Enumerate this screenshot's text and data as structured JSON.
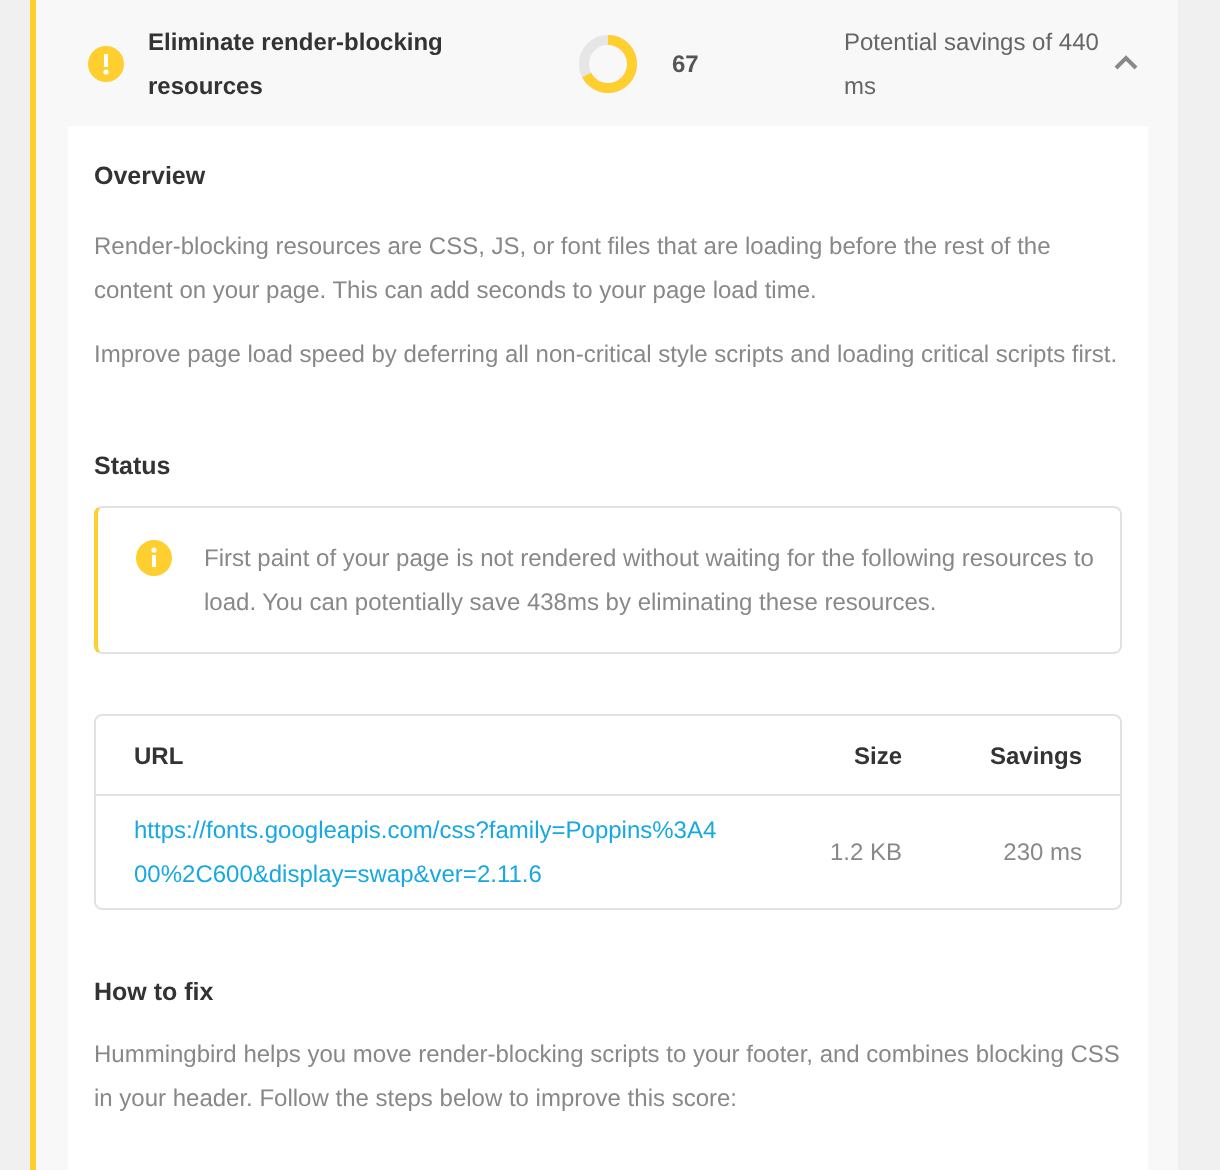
{
  "audit": {
    "title": "Eliminate render-blocking resources",
    "score": "67",
    "savings": "Potential savings of 440 ms",
    "expanded": true
  },
  "overview": {
    "heading": "Overview",
    "paragraphs": [
      "Render-blocking resources are CSS, JS, or font files that are loading before the rest of the content on your page. This can add seconds to your page load time.",
      "Improve page load speed by deferring all non-critical style scripts and loading critical scripts first."
    ]
  },
  "status": {
    "heading": "Status",
    "notice": "First paint of your page is not rendered without waiting for the following resources to load. You can potentially save 438ms by eliminating these resources."
  },
  "table": {
    "columns": [
      "URL",
      "Size",
      "Savings"
    ],
    "rows": [
      {
        "url": "https://fonts.googleapis.com/css?family=Poppins%3A400%2C600&display=swap&ver=2.11.6",
        "size": "1.2 KB",
        "savings": "230 ms"
      }
    ]
  },
  "how_to_fix": {
    "heading": "How to fix",
    "text": "Hummingbird helps you move render-blocking scripts to your footer, and combines blocking CSS in your header. Follow the steps below to improve this score:"
  }
}
